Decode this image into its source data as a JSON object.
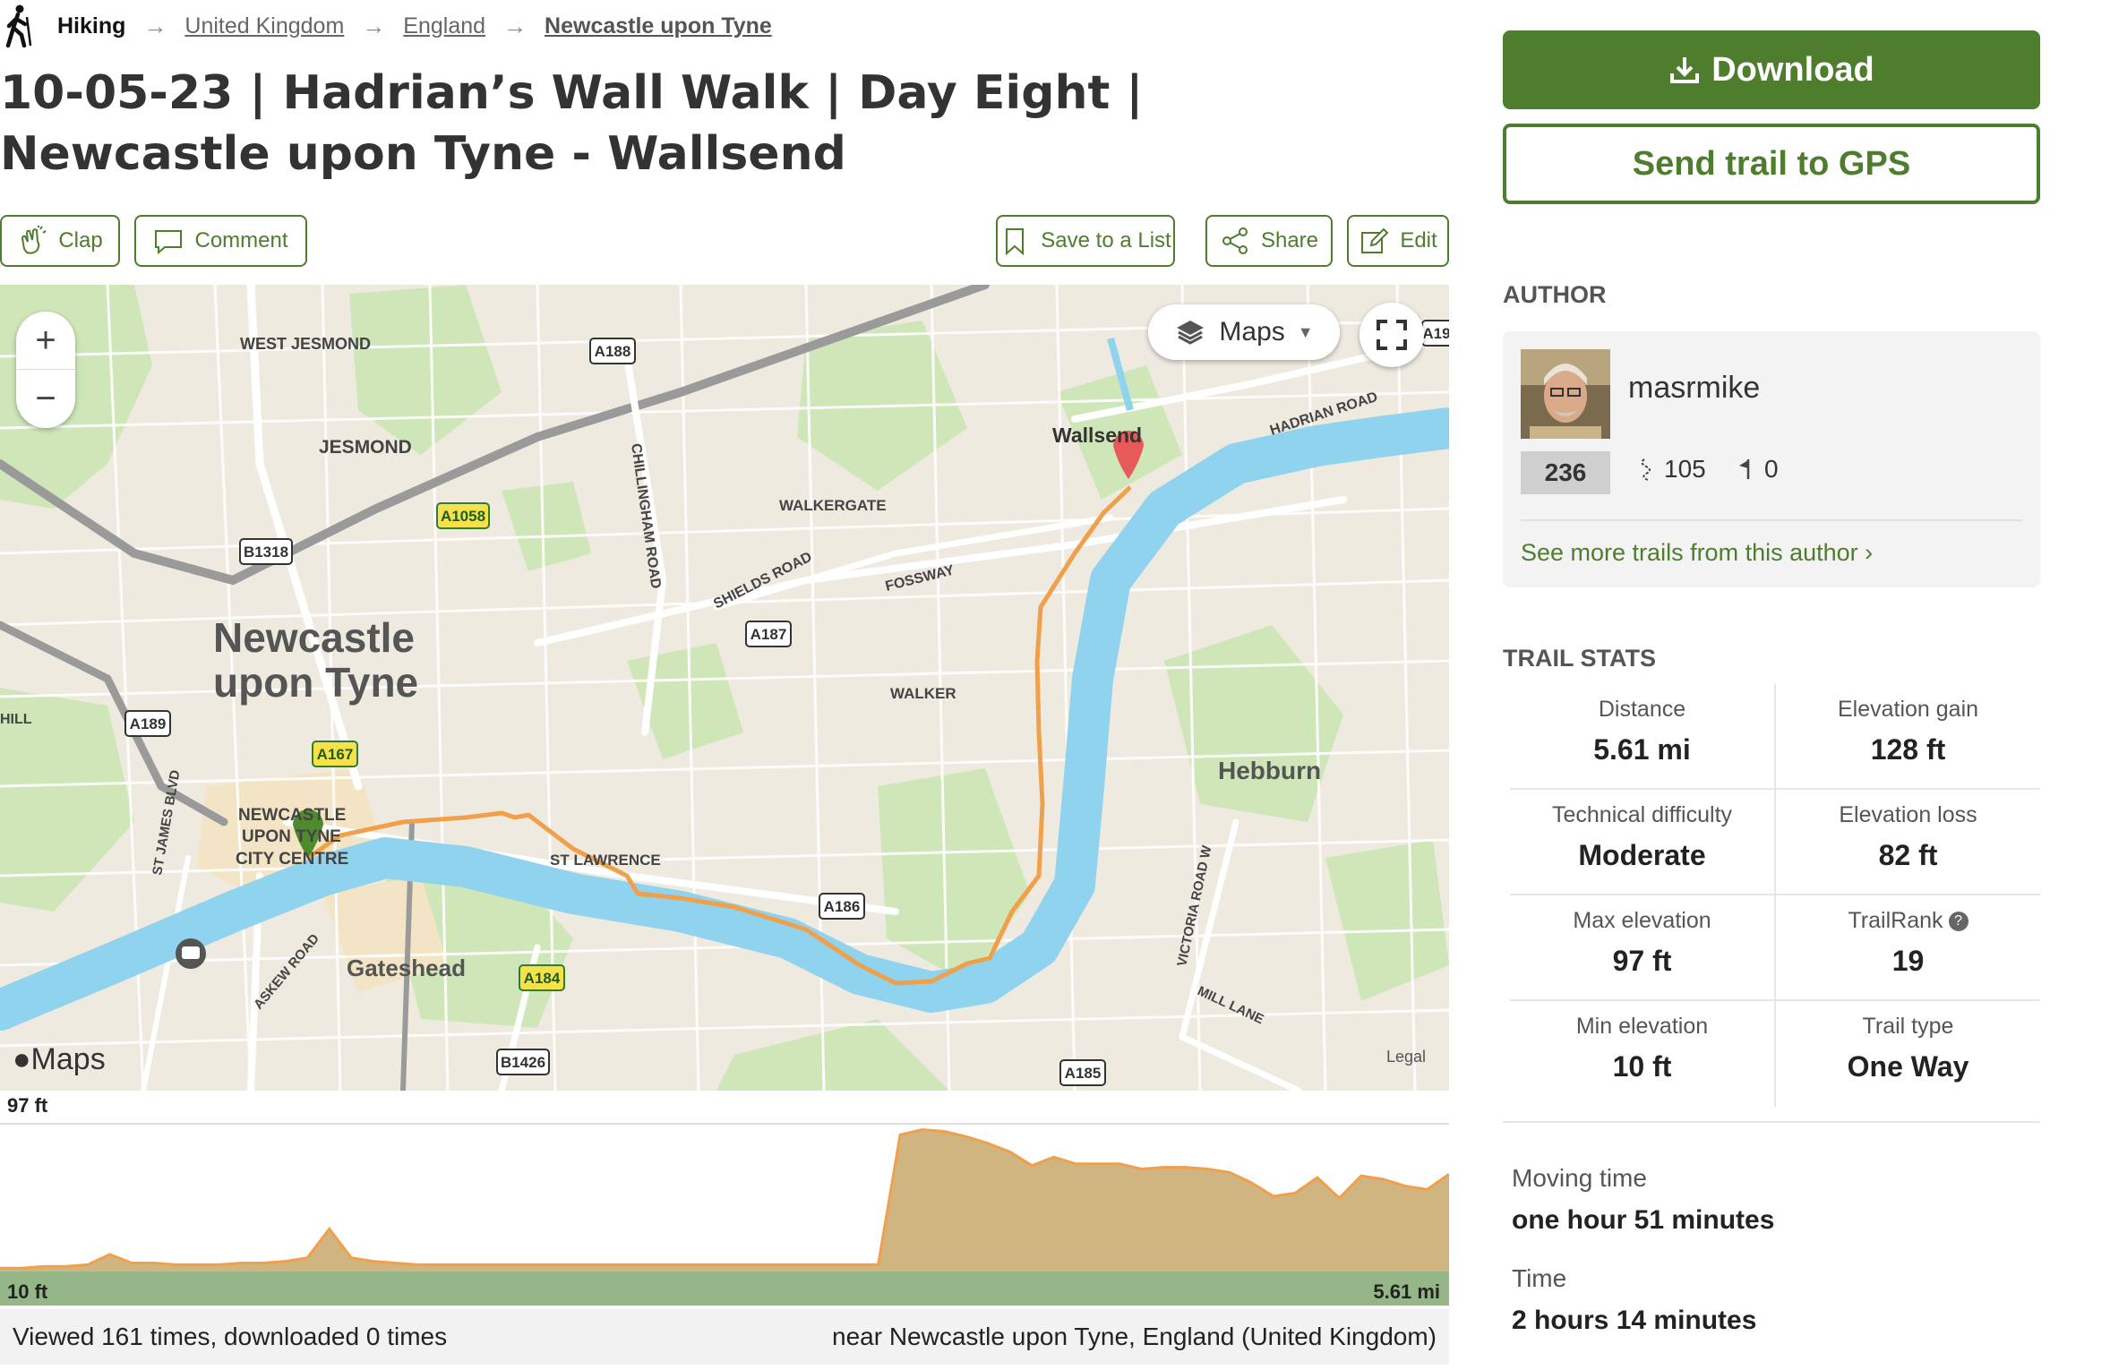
{
  "breadcrumb": {
    "activity": "Hiking",
    "items": [
      "United Kingdom",
      "England",
      "Newcastle upon Tyne"
    ]
  },
  "title": "10-05-23 | Hadrian’s Wall Walk | Day Eight | Newcastle upon Tyne - Wallsend",
  "actions": {
    "clap": "Clap",
    "comment": "Comment",
    "save": "Save to a List",
    "share": "Share",
    "edit": "Edit"
  },
  "map": {
    "maps_button": "Maps",
    "logo": "Maps",
    "legal": "Legal",
    "place_labels": [
      "WEST JESMOND",
      "JESMOND",
      "Newcastle",
      "upon Tyne",
      "NEWCASTLE",
      "UPON TYNE",
      "CITY CENTRE",
      "Gateshead",
      "WALKERGATE",
      "FOSSWAY",
      "SHIELDS ROAD",
      "CHILLINGHAM ROAD",
      "WALKER",
      "ST LAWRENCE",
      "Wallsend",
      "HADRIAN ROAD",
      "Hebburn",
      "VICTORIA ROAD W",
      "MILL LANE",
      "ASKEW ROAD",
      "ST JAMES BLVD",
      "HILL"
    ],
    "road_shields": [
      "A188",
      "A1058",
      "B1318",
      "A187",
      "A189",
      "A167",
      "A186",
      "A184",
      "B1426",
      "A185",
      "A19"
    ]
  },
  "elevation": {
    "max_label": "97 ft",
    "min_label": "10 ft",
    "distance_label": "5.61 mi",
    "profile_ft": [
      12,
      12,
      13,
      13,
      14,
      20,
      15,
      15,
      14,
      14,
      14,
      15,
      15,
      16,
      18,
      35,
      18,
      16,
      15,
      14,
      14,
      14,
      14,
      14,
      14,
      14,
      14,
      14,
      14,
      14,
      14,
      14,
      14,
      14,
      14,
      14,
      14,
      14,
      14,
      14,
      14,
      90,
      93,
      92,
      89,
      85,
      80,
      72,
      77,
      73,
      73,
      73,
      70,
      71,
      71,
      70,
      68,
      62,
      54,
      56,
      65,
      53,
      66,
      64,
      60,
      58,
      67
    ]
  },
  "footer": {
    "views": "Viewed 161 times, downloaded 0 times",
    "location": "near Newcastle upon Tyne, England (United Kingdom)"
  },
  "sidebar": {
    "download": "Download",
    "send_gps": "Send trail to GPS",
    "author_heading": "AUTHOR",
    "author_name": "masrmike",
    "author_rank": "236",
    "author_trails": "105",
    "author_followers": "0",
    "author_more": "See more trails from this author ›",
    "stats_heading": "TRAIL STATS",
    "stats": [
      [
        {
          "label": "Distance",
          "value": "5.61 mi"
        },
        {
          "label": "Elevation gain",
          "value": "128 ft"
        }
      ],
      [
        {
          "label": "Technical difficulty",
          "value": "Moderate"
        },
        {
          "label": "Elevation loss",
          "value": "82 ft"
        }
      ],
      [
        {
          "label": "Max elevation",
          "value": "97 ft"
        },
        {
          "label": "TrailRank",
          "value": "19"
        }
      ],
      [
        {
          "label": "Min elevation",
          "value": "10 ft"
        },
        {
          "label": "Trail type",
          "value": "One Way"
        }
      ]
    ],
    "moving_time_label": "Moving time",
    "moving_time": "one hour 51 minutes",
    "time_label": "Time",
    "time": "2 hours 14 minutes"
  },
  "colors": {
    "brand_green": "#4e7d2e",
    "river": "#8fd3ee",
    "route": "#f0a04b",
    "start_marker": "#4e8a2e",
    "end_marker": "#e85a5a"
  }
}
